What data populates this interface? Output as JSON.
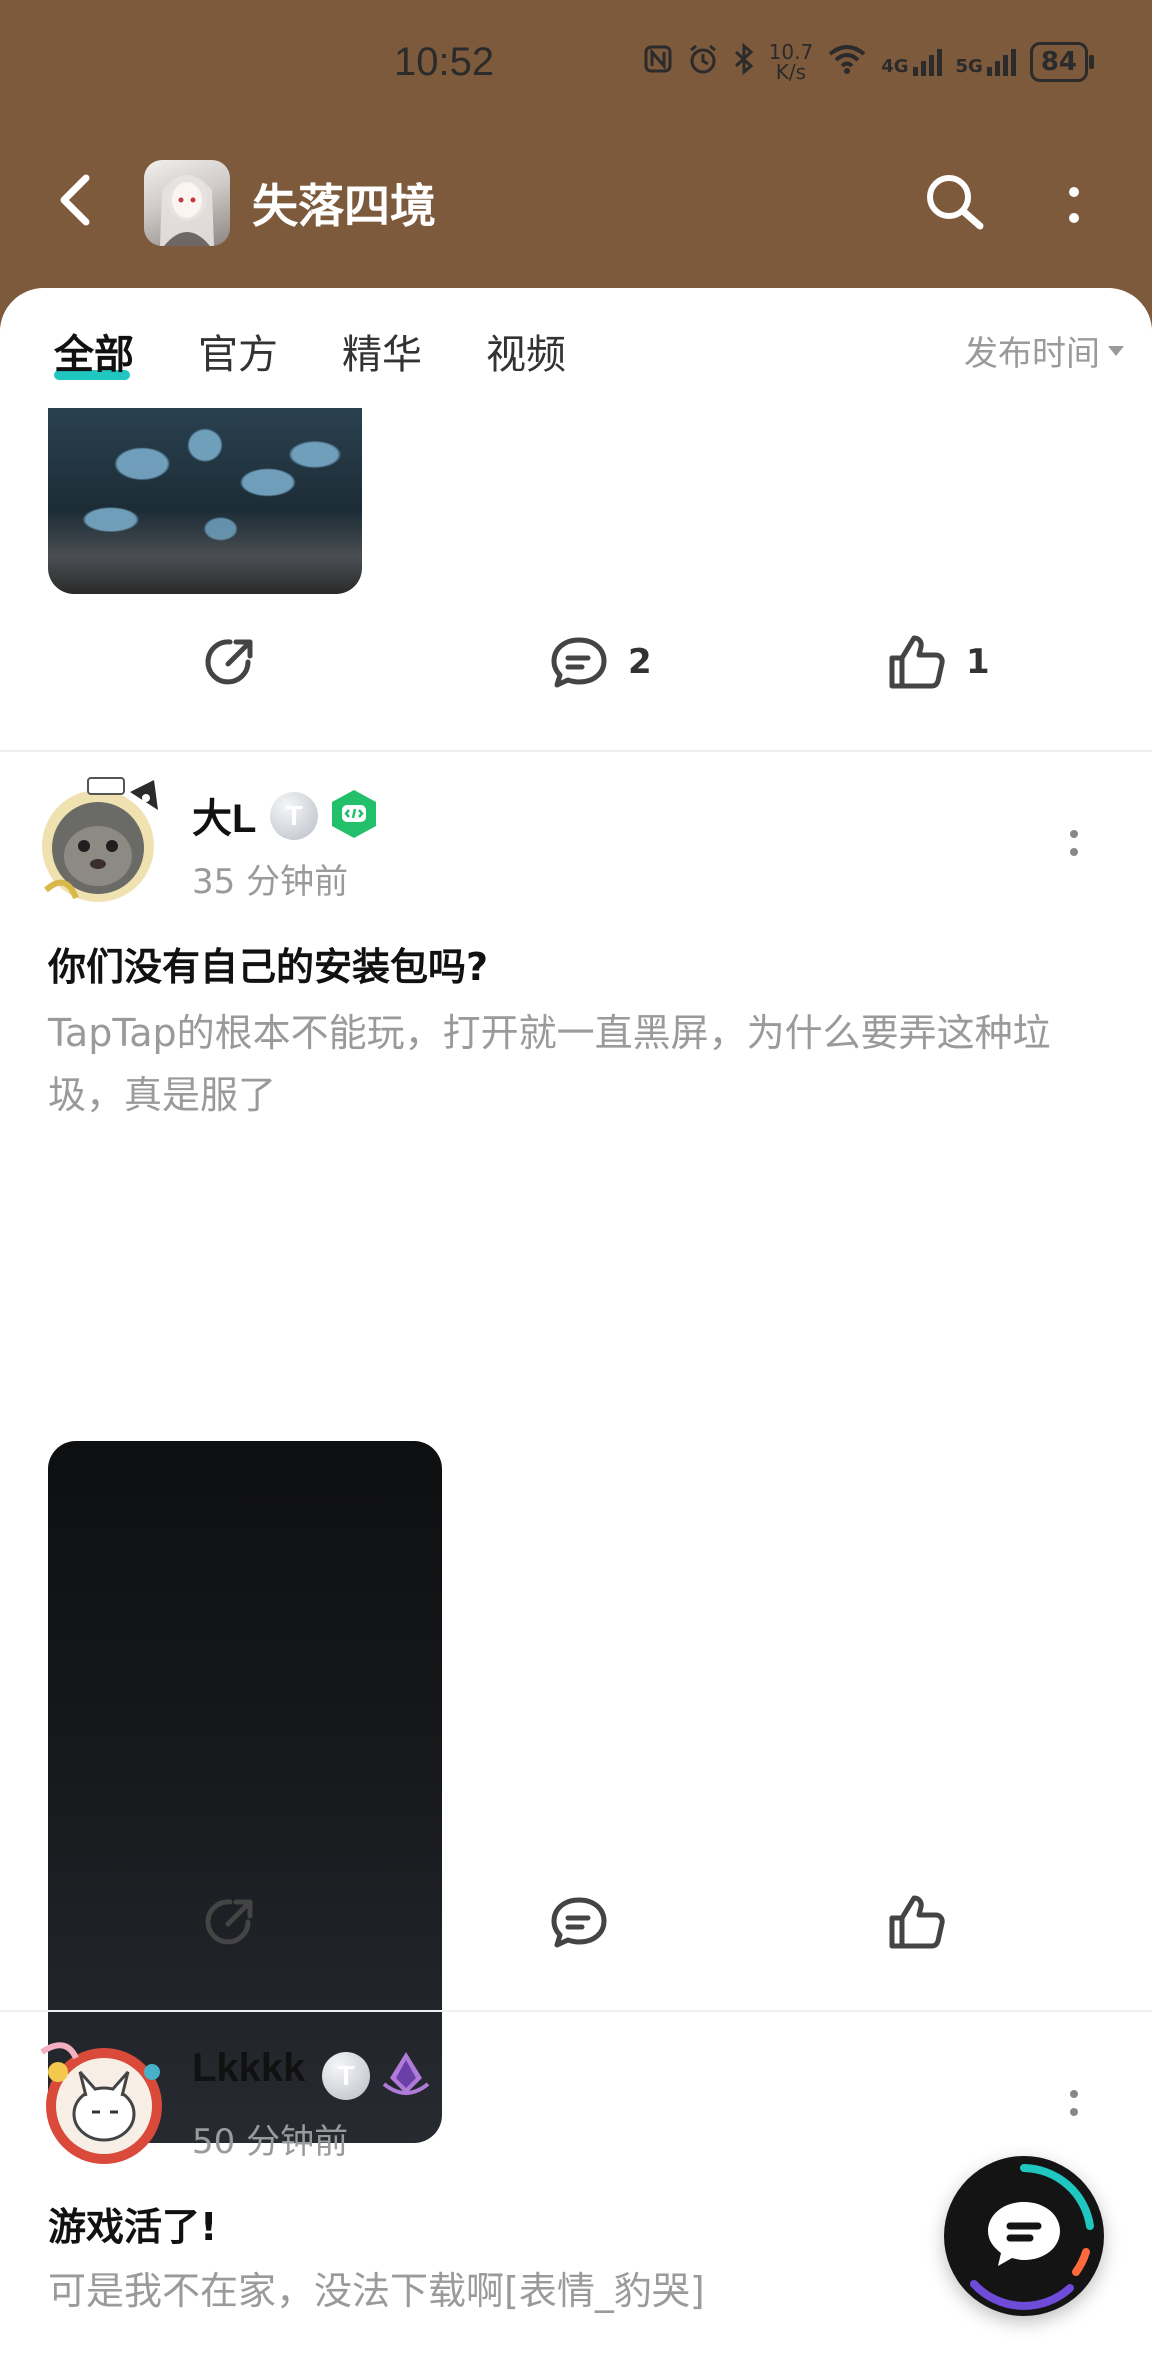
{
  "status_bar": {
    "time": "10:52",
    "net_speed_top": "10.7",
    "net_speed_bottom": "K/s",
    "sig1_label": "4G",
    "sig2_label": "5G",
    "battery": "84"
  },
  "header": {
    "title": "失落四境"
  },
  "tabs": {
    "items": [
      {
        "label": "全部"
      },
      {
        "label": "官方"
      },
      {
        "label": "精华"
      },
      {
        "label": "视频"
      }
    ],
    "sort_label": "发布时间"
  },
  "post0": {
    "comment_count": "2",
    "like_count": "1"
  },
  "post1": {
    "username": "大L",
    "level_badge": "T",
    "time": "35 分钟前",
    "title": "你们没有自己的安装包吗?",
    "body": "TapTap的根本不能玩，打开就一直黑屏，为什么要弄这种垃圾，真是服了"
  },
  "post2": {
    "username": "Lkkkk",
    "level_badge": "T",
    "time": "50 分钟前",
    "title": "游戏活了!",
    "body": "可是我不在家，没法下载啊[表情_豹哭]"
  },
  "colors": {
    "header_bg": "#7d5a3c",
    "accent": "#1fc7c0"
  }
}
